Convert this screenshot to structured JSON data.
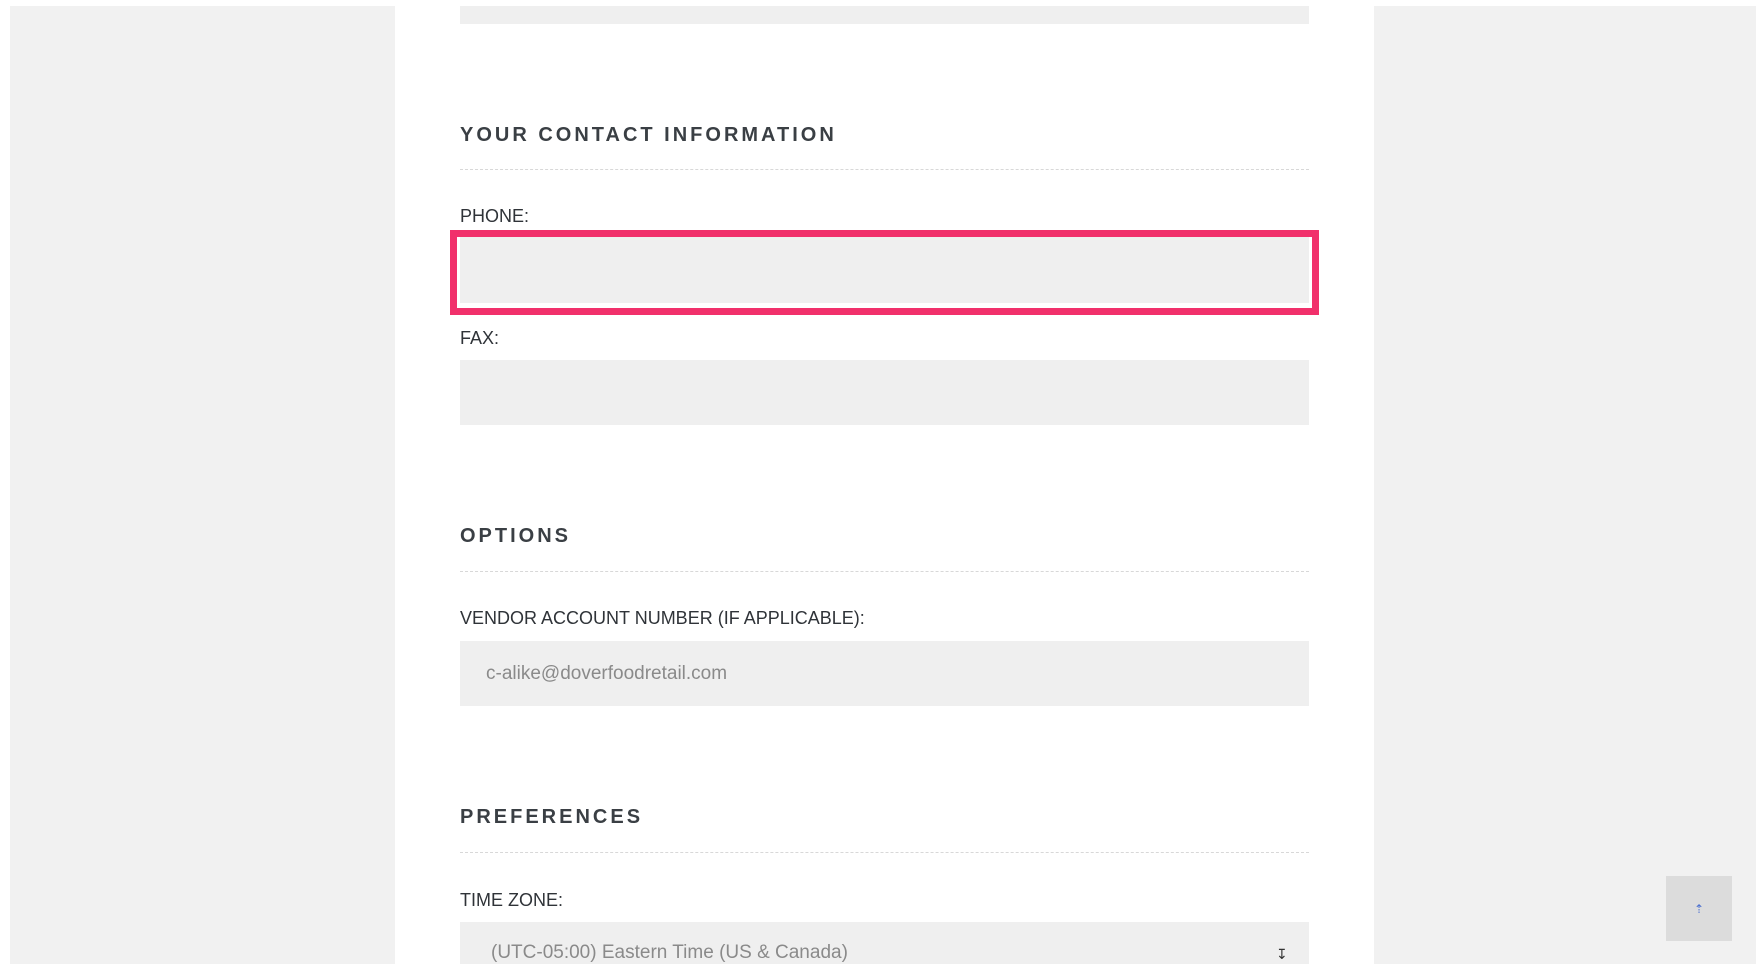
{
  "sections": {
    "contact": {
      "title": "YOUR CONTACT INFORMATION",
      "phone_label": "PHONE:",
      "phone_value": "",
      "fax_label": "FAX:",
      "fax_value": ""
    },
    "options": {
      "title": "OPTIONS",
      "vendor_label": "VENDOR ACCOUNT NUMBER (IF APPLICABLE):",
      "vendor_value": "c-alike@doverfoodretail.com"
    },
    "preferences": {
      "title": "PREFERENCES",
      "timezone_label": "TIME ZONE:",
      "timezone_value": "(UTC-05:00) Eastern Time (US & Canada)"
    }
  },
  "colors": {
    "highlight": "#f1306b",
    "field_bg": "#efefef",
    "page_bg": "#f1f1f1",
    "scroll_arrow": "#4a6fd0"
  },
  "icons": {
    "select_arrow": "select-arrow-icon",
    "scroll_top": "arrow-up-icon"
  }
}
